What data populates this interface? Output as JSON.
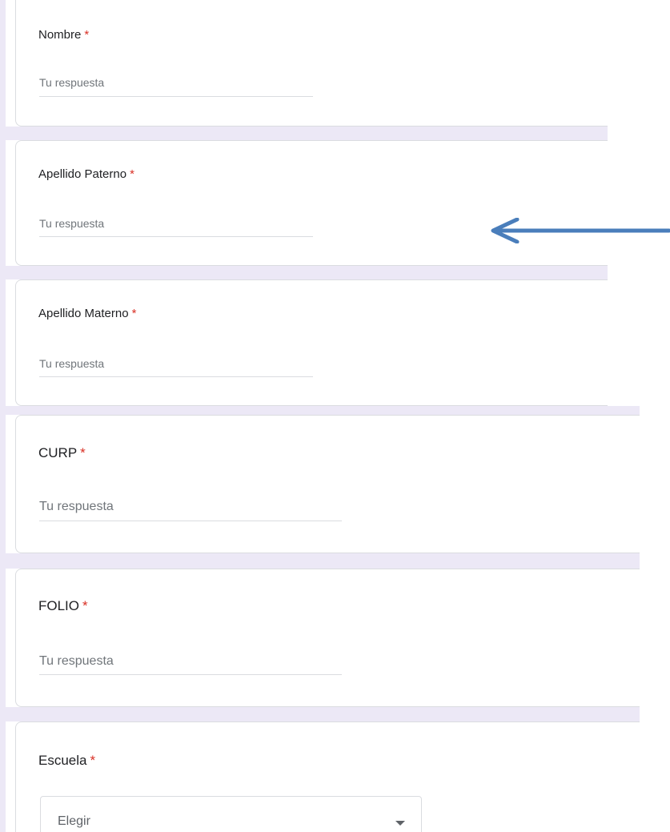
{
  "required_marker": "*",
  "answer_placeholder": "Tu respuesta",
  "questions": [
    {
      "label": "Nombre",
      "type": "short-text"
    },
    {
      "label": "Apellido Paterno",
      "type": "short-text"
    },
    {
      "label": "Apellido Materno",
      "type": "short-text"
    },
    {
      "label": "CURP",
      "type": "short-text"
    },
    {
      "label": "FOLIO",
      "type": "short-text"
    },
    {
      "label": "Escuela",
      "type": "dropdown",
      "selected": "Elegir"
    }
  ],
  "annotation": {
    "icon": "left-arrow-icon",
    "color": "#4a7ebb"
  },
  "colors": {
    "required": "#d93025",
    "background_tint": "#ece8f6",
    "card_border": "#dadce0"
  }
}
